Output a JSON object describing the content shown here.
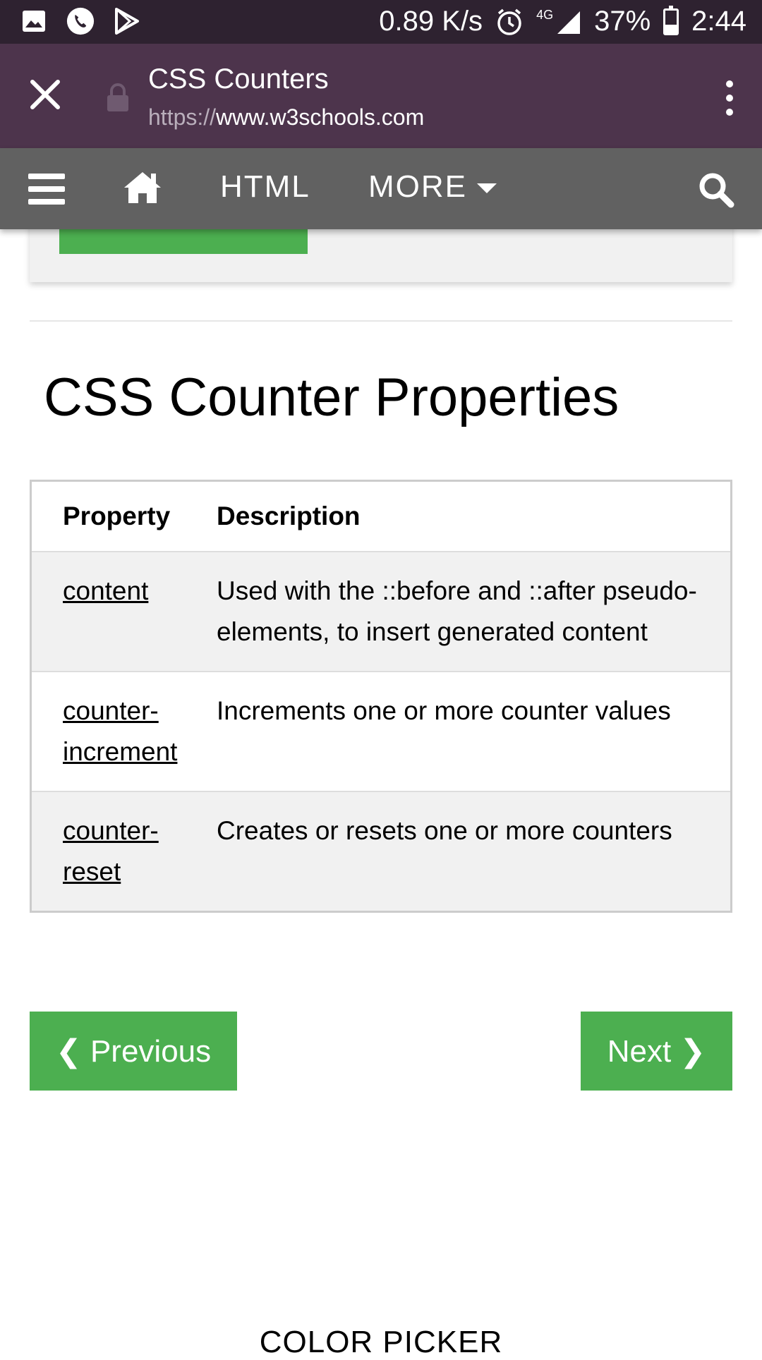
{
  "status_bar": {
    "network_speed": "0.89 K/s",
    "network_type": "4G",
    "battery_percent": "37%",
    "battery_level": 0.37,
    "time": "2:44",
    "icons": [
      "image-icon",
      "phone-icon",
      "play-store-icon",
      "alarm-icon",
      "signal-icon",
      "battery-icon"
    ]
  },
  "browser": {
    "page_title": "CSS Counters",
    "url_scheme": "https://",
    "url_host": "www.w3schools.com"
  },
  "navbar": {
    "html_label": "HTML",
    "more_label": "MORE"
  },
  "main": {
    "heading": "CSS Counter Properties",
    "table": {
      "headers": [
        "Property",
        "Description"
      ],
      "rows": [
        {
          "property": "content",
          "description": "Used with the ::before and ::after pseudo-elements, to insert generated content"
        },
        {
          "property": "counter-increment",
          "description": "Increments one or more counter values"
        },
        {
          "property": "counter-reset",
          "description": "Creates or resets one or more counters"
        }
      ]
    },
    "prev_label": "❮ Previous",
    "next_label": "Next ❯",
    "color_picker_label": "COLOR PICKER"
  },
  "colors": {
    "status_bar_bg": "#2e2230",
    "browser_bar_bg": "#4d344c",
    "navbar_bg": "#616161",
    "accent_green": "#4caf50"
  }
}
